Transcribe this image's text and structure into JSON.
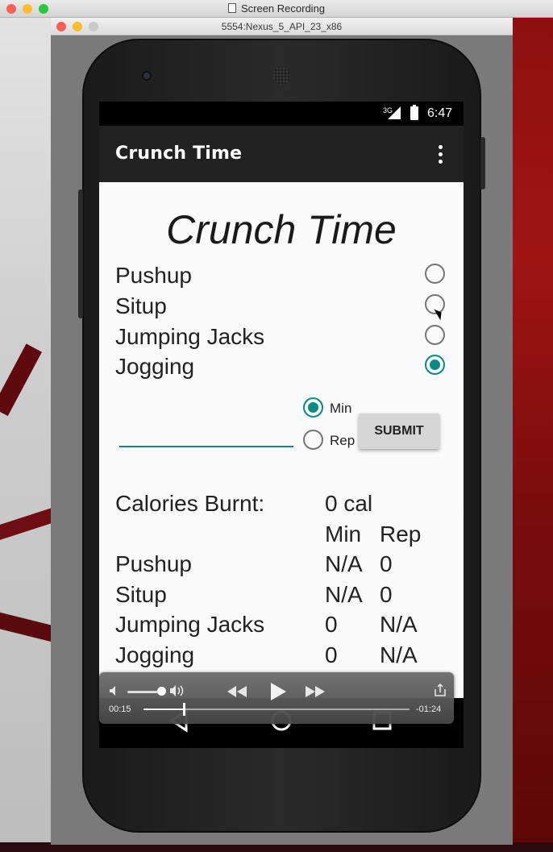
{
  "mac_window": {
    "title": "Screen Recording"
  },
  "emulator": {
    "title": "5554:Nexus_5_API_23_x86"
  },
  "status_bar": {
    "network": "3G",
    "time": "6:47"
  },
  "app_bar": {
    "title": "Crunch Time",
    "overflow_icon": "more-vert-icon"
  },
  "main": {
    "heading": "Crunch Time",
    "exercises": [
      {
        "label": "Pushup",
        "selected": false
      },
      {
        "label": "Situp",
        "selected": false
      },
      {
        "label": "Jumping Jacks",
        "selected": false
      },
      {
        "label": "Jogging",
        "selected": true
      }
    ],
    "amount_input": {
      "value": "",
      "placeholder": ""
    },
    "units": [
      {
        "label": "Min",
        "selected": true
      },
      {
        "label": "Rep",
        "selected": false
      }
    ],
    "submit_label": "SUBMIT",
    "calories": {
      "label": "Calories Burnt:",
      "value": "0 cal"
    },
    "table": {
      "headers": [
        "Min",
        "Rep"
      ],
      "rows": [
        {
          "name": "Pushup",
          "min": "N/A",
          "rep": "0"
        },
        {
          "name": "Situp",
          "min": "N/A",
          "rep": "0"
        },
        {
          "name": "Jumping Jacks",
          "min": "0",
          "rep": "N/A"
        },
        {
          "name": "Jogging",
          "min": "0",
          "rep": "N/A"
        }
      ]
    }
  },
  "player": {
    "elapsed": "00:15",
    "remaining": "-01:24",
    "volume": 0.8,
    "progress": 0.15,
    "icons": [
      "volume-low-icon",
      "volume-high-icon",
      "rewind-icon",
      "play-icon",
      "fast-forward-icon",
      "share-icon"
    ]
  },
  "colors": {
    "accent": "#0b8a84",
    "app_bar": "#212121",
    "content_bg": "#fafafa"
  }
}
